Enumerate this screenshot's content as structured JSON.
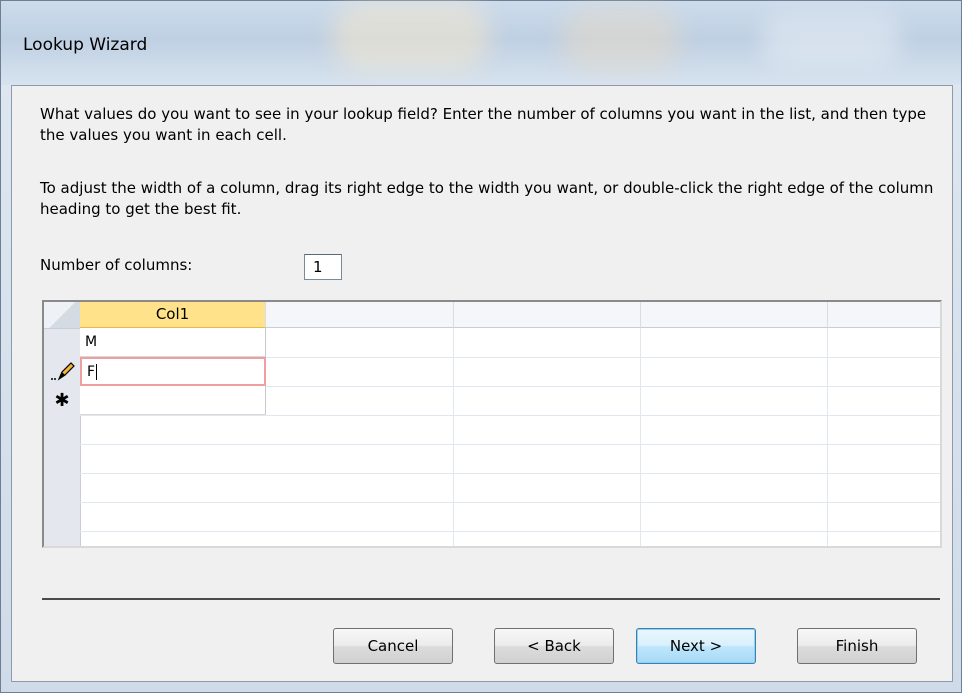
{
  "window": {
    "title": "Lookup Wizard"
  },
  "instructions": {
    "line1": "What values do you want to see in your lookup field? Enter the number of columns you want in the list, and then type the values you want in each cell.",
    "line2": "To adjust the width of a column, drag its right edge to the width you want, or double-click the right edge of the column heading to get the best fit."
  },
  "columns_field": {
    "label": "Number of columns:",
    "value": "1"
  },
  "grid": {
    "column_header": "Col1",
    "rows": [
      "M",
      "F",
      ""
    ]
  },
  "buttons": {
    "cancel": "Cancel",
    "back": "< Back",
    "next": "Next >",
    "finish": "Finish"
  },
  "colors": {
    "active_header": "#ffe28a",
    "edit_cell_border": "#eea0a0",
    "default_button": "#3c7fb1"
  }
}
